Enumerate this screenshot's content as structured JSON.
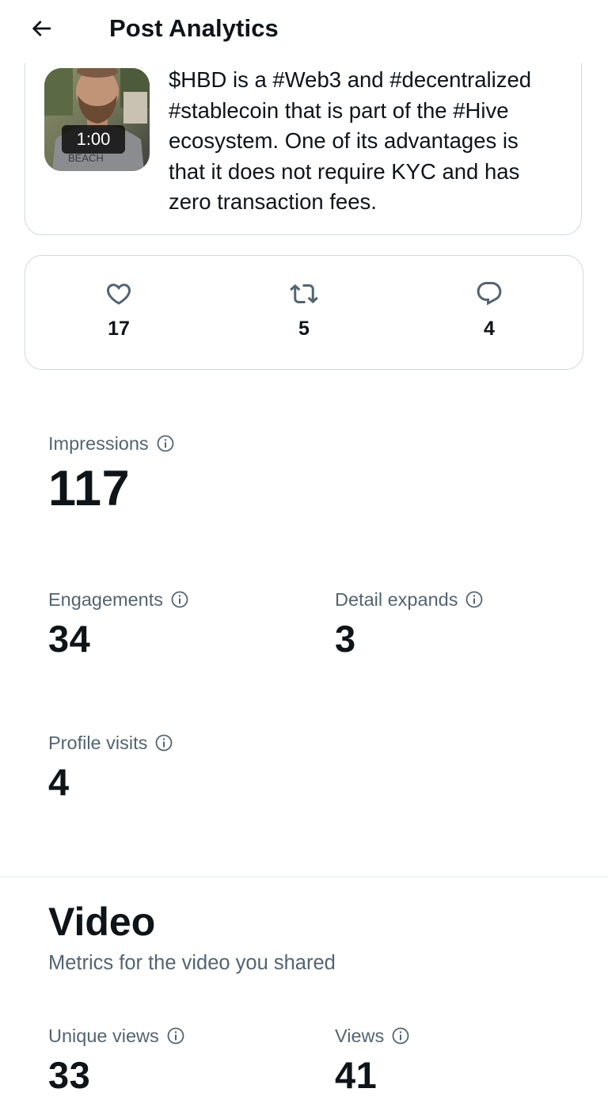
{
  "header": {
    "title": "Post Analytics",
    "back_icon": "arrow-left-icon"
  },
  "post": {
    "thumbnail_duration": "1:00",
    "text": "$HBD is a #Web3 and #decentralized\n#stablecoin that is part of the #Hive\necosystem. One of its advantages is\nthat it does not require KYC and has\nzero transaction fees."
  },
  "stats": {
    "likes": {
      "icon": "heart-icon",
      "count": "17"
    },
    "reposts": {
      "icon": "repost-icon",
      "count": "5"
    },
    "replies": {
      "icon": "reply-icon",
      "count": "4"
    }
  },
  "metrics": {
    "impressions": {
      "label": "Impressions",
      "value": "117"
    },
    "engagements": {
      "label": "Engagements",
      "value": "34"
    },
    "detail_expands": {
      "label": "Detail expands",
      "value": "3"
    },
    "profile_visits": {
      "label": "Profile visits",
      "value": "4"
    }
  },
  "video": {
    "title": "Video",
    "subtitle": "Metrics for the video you shared",
    "unique_views": {
      "label": "Unique views",
      "value": "33"
    },
    "views": {
      "label": "Views",
      "value": "41"
    }
  },
  "colors": {
    "text_primary": "#0f1419",
    "text_secondary": "#536471",
    "border": "#cfd9de"
  }
}
